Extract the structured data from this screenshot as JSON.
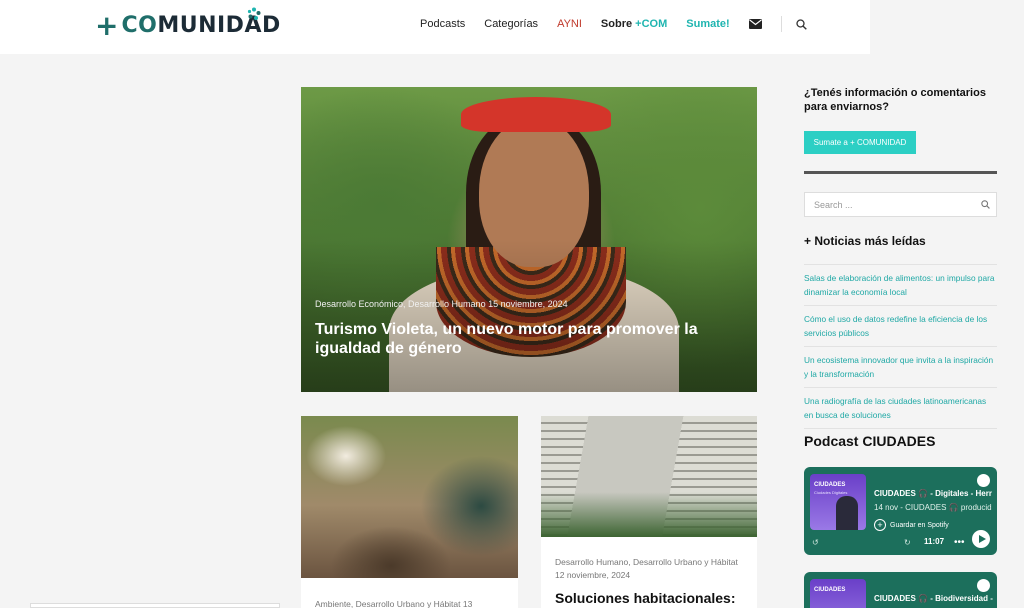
{
  "logo": {
    "plus": "+",
    "text_co": "CO",
    "text_rest": "MUNIDAD"
  },
  "nav": {
    "items": [
      {
        "label": "Podcasts"
      },
      {
        "label": "Categorías"
      },
      {
        "label": "AYNI"
      },
      {
        "label_main": "Sobre",
        "label_accent": " +COM"
      },
      {
        "label": "Sumate!"
      }
    ],
    "icons": [
      "envelope-icon",
      "search-icon"
    ]
  },
  "hero": {
    "meta": "Desarrollo Económico, Desarrollo Humano   15 noviembre, 2024",
    "title": "Turismo Violeta, un nuevo motor para promover la igualdad de género"
  },
  "cards": [
    {
      "meta": "Ambiente, Desarrollo Urbano y Hábitat   13"
    },
    {
      "meta": "Desarrollo Humano, Desarrollo Urbano y Hábitat   12 noviembre, 2024",
      "title": "Soluciones habitacionales:"
    }
  ],
  "sidebar": {
    "question": "¿Tenés información o comentarios para enviarnos?",
    "button": "Sumate a + COMUNIDAD",
    "search_placeholder": "Search ...",
    "news_heading": "+ Noticias más leídas",
    "news": [
      "Salas de elaboración de alimentos: un impulso para dinamizar la economía local",
      "Cómo el uso de datos redefine la eficiencia de los servicios públicos",
      "Un ecosistema innovador que invita a la inspiración y la transformación",
      "Una radiografía de las ciudades latinoamericanas en busca de soluciones"
    ],
    "podcast_heading": "Podcast CIUDADES",
    "podcasts": [
      {
        "thumb_label": "CIUDADES",
        "thumb_sub": "Ciudades Digitales",
        "title": "CIUDADES 🎧 - Digitales - Herr",
        "sub": "14 nov - CIUDADES 🎧 producid",
        "save": "Guardar en Spotify",
        "time": "11:07",
        "more": "•••"
      },
      {
        "thumb_label": "CIUDADES",
        "title": "CIUDADES 🎧 - Biodiversidad -"
      }
    ]
  },
  "colors": {
    "accent": "#1fb5b0",
    "button": "#2ccfc4",
    "brand": "#1f6e6a",
    "ayni": "#c0392b",
    "podcast_bg": "#1c6f5c"
  }
}
